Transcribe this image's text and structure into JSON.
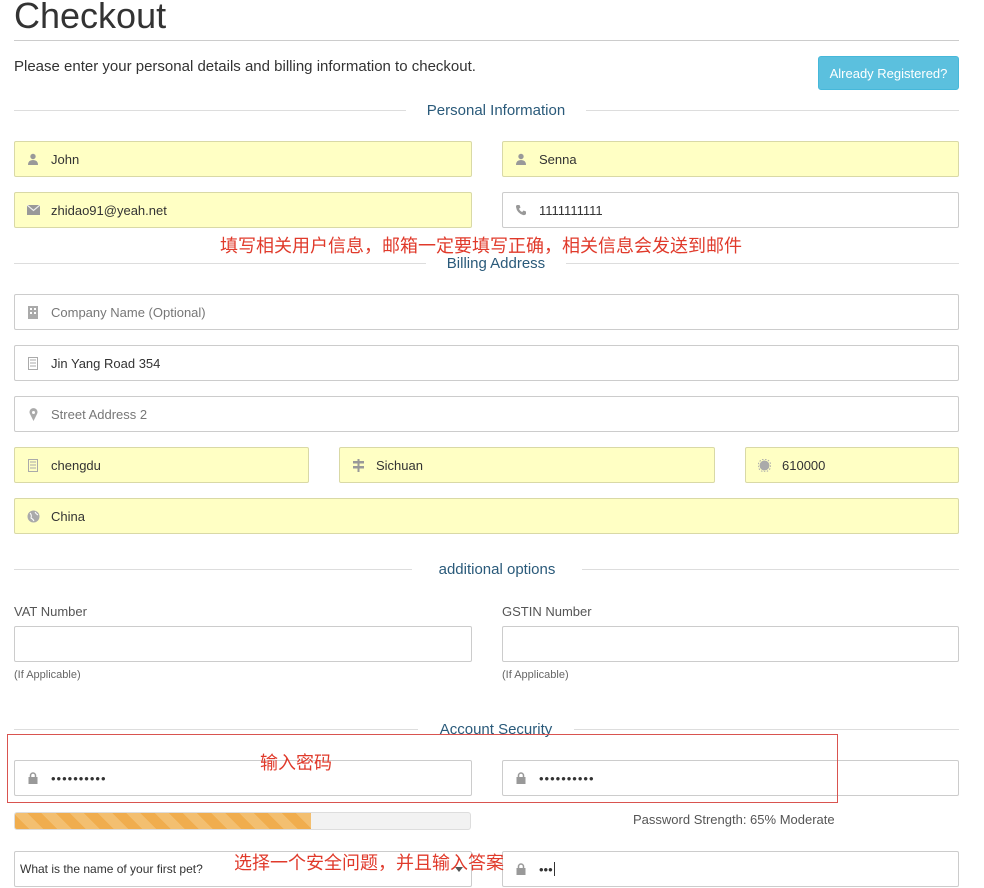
{
  "page": {
    "title": "Checkout",
    "intro": "Please enter your personal details and billing information to checkout.",
    "already_registered": "Already Registered?"
  },
  "sections": {
    "personal": "Personal Information",
    "billing": "Billing Address",
    "additional": "additional options",
    "security": "Account Security"
  },
  "personal": {
    "first_name": "John",
    "last_name": "Senna",
    "email": "zhidao91@yeah.net",
    "phone": "1111111111"
  },
  "billing": {
    "company_placeholder": "Company Name (Optional)",
    "address1": "Jin Yang Road 354",
    "address2_placeholder": "Street Address 2",
    "city": "chengdu",
    "state": "Sichuan",
    "postcode": "610000",
    "country": "China"
  },
  "additional": {
    "vat_label": "VAT Number",
    "vat_help": "(If Applicable)",
    "gstin_label": "GSTIN Number",
    "gstin_help": "(If Applicable)"
  },
  "security": {
    "password": "••••••••••",
    "password_confirm": "••••••••••",
    "strength_percent": 65,
    "strength_text": "Password Strength: 65% Moderate",
    "question_selected": "What is the name of your first pet?",
    "answer": "•••"
  },
  "annotations": {
    "note1": "填写相关用户信息，邮箱一定要填写正确，相关信息会发送到邮件",
    "note2": "输入密码",
    "note3": "选择一个安全问题，并且输入答案"
  },
  "colors": {
    "autofill": "#ffffc4",
    "accent": "#5bc0de",
    "progress": "#f0ad4e",
    "annotation": "#e03a2b"
  },
  "icons": {
    "first_name": "user-icon",
    "last_name": "user-icon",
    "email": "envelope-icon",
    "phone": "phone-icon",
    "company": "building-icon",
    "address1": "building-icon",
    "address2": "map-marker-icon",
    "city": "building-icon",
    "state": "signpost-icon",
    "postcode": "certificate-icon",
    "country": "globe-icon",
    "password": "lock-icon"
  }
}
